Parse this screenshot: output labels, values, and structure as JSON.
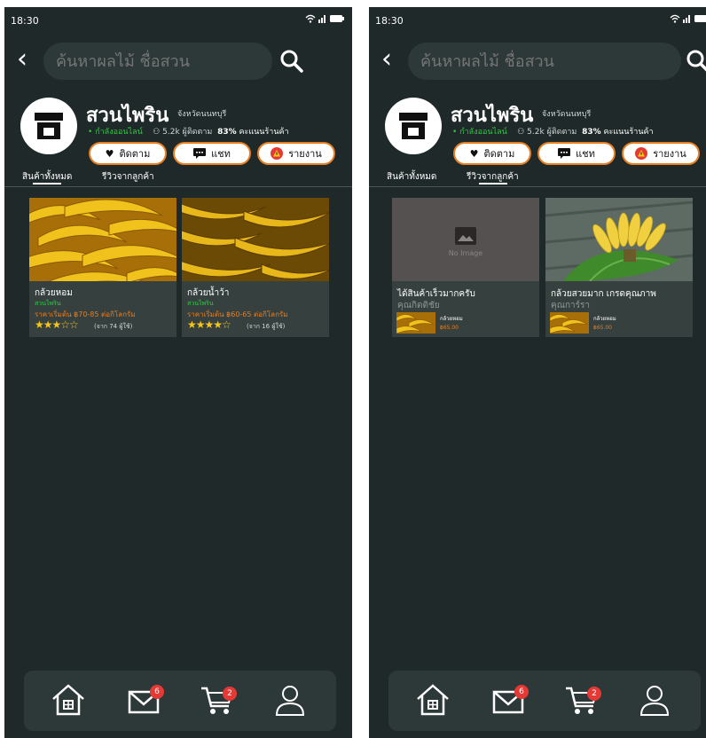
{
  "status": {
    "time": "18:30"
  },
  "search": {
    "placeholder": "ค้นหาผลไม้ ชื่อสวน"
  },
  "shop": {
    "name": "สวนไพริน",
    "province": "จังหวัดนนทบุรี",
    "online": "• กำลังออนไลน์",
    "followers": "5.2k ผู้ติดตาม",
    "score_pct": "83%",
    "score_label": "คะแนนร้านค้า"
  },
  "actions": {
    "follow": "ติดตาม",
    "chat": "แชท",
    "report": "รายงาน"
  },
  "tabs": {
    "all": "สินค้าทั้งหมด",
    "reviews": "รีวิวจากลูกค้า"
  },
  "products": [
    {
      "name": "กล้วยหอม",
      "shop": "สวนไพริน",
      "price": "ราคาเริ่มต้น ฿70-85 ต่อกิโลกรัม",
      "stars": "★★★☆☆",
      "count": "(จาก 74 ผู้ใช้)"
    },
    {
      "name": "กล้วยน้ำว้า",
      "shop": "สวนไพริน",
      "price": "ราคาเริ่มต้น ฿60-65 ต่อกิโลกรัม",
      "stars": "★★★★☆",
      "count": "(จาก 16 ผู้ใช้)"
    }
  ],
  "reviews": [
    {
      "title": "ได้สินค้าเร็วมากครับ",
      "user": "คุณกิตติชัย",
      "no_image": "No Image",
      "product": "กล้วยหอม",
      "price": "฿65.00"
    },
    {
      "title": "กล้วยสวยมาก เกรดคุณภาพ",
      "user": "คุณการ์รา",
      "product": "กล้วยหอม",
      "price": "฿65.00"
    }
  ],
  "nav": {
    "inbox_badge": "6",
    "cart_badge": "2"
  },
  "colors": {
    "background": "#202929",
    "accent": "#e67e22",
    "online": "#2ecc40",
    "badge": "#e53935"
  }
}
